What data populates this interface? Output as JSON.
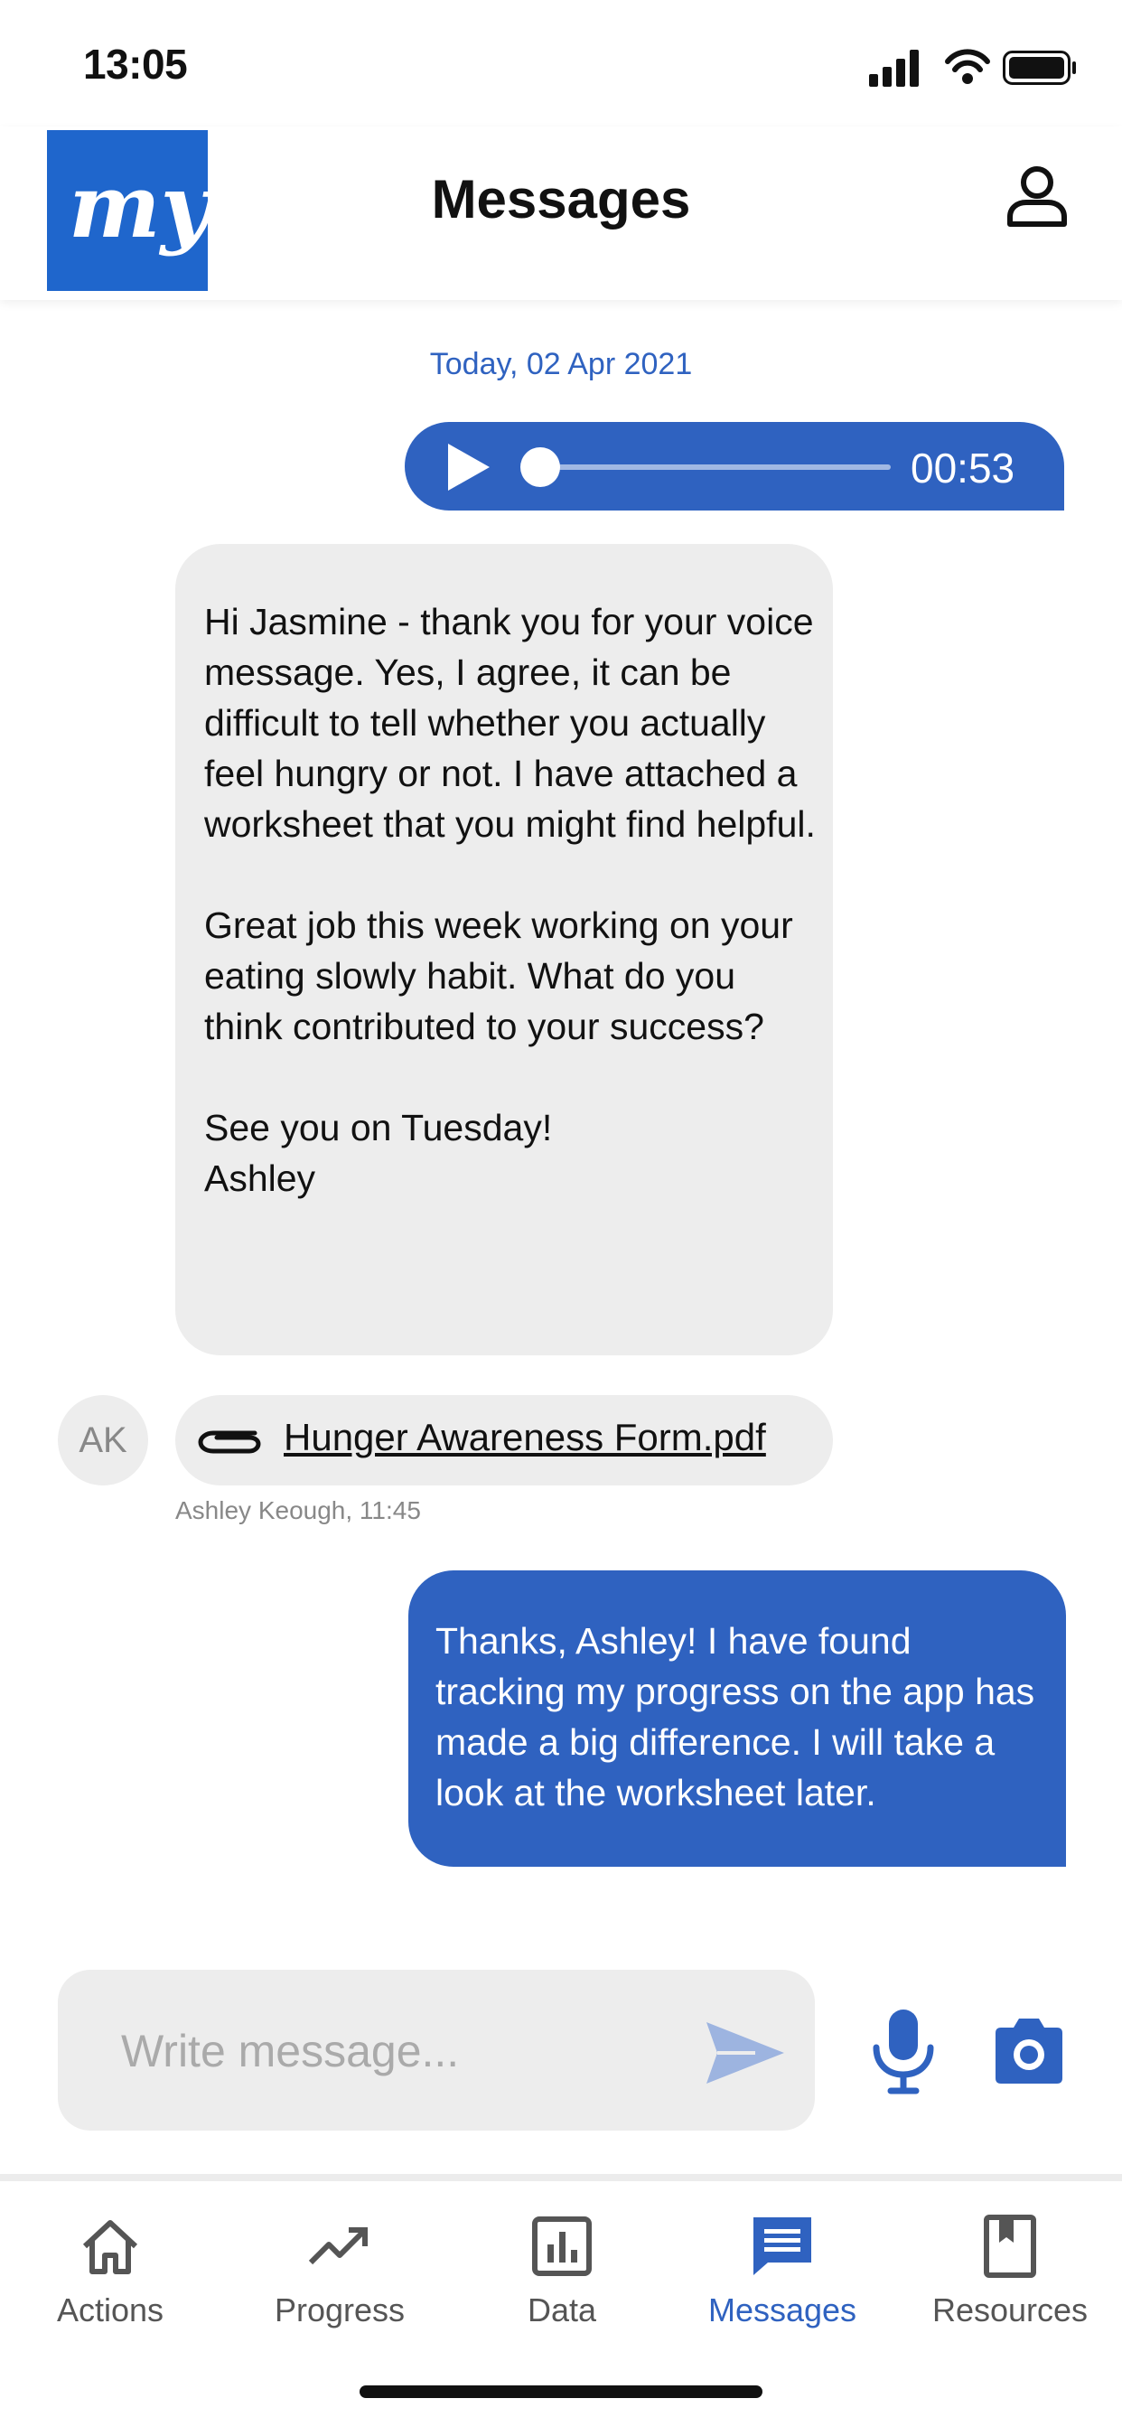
{
  "status_bar": {
    "time": "13:05"
  },
  "header": {
    "logo_text": "my",
    "title": "Messages"
  },
  "conversation": {
    "date_label": "Today, 02 Apr 2021",
    "voice_message": {
      "duration": "00:53",
      "progress": 0
    },
    "incoming_message": {
      "text": "Hi Jasmine - thank you for your voice message. Yes, I agree, it can be difficult to tell whether you actually feel hungry or not. I have attached a worksheet that you might find helpful.\n\nGreat job this week working on your eating slowly habit. What do you think contributed to your success?\n\nSee you on Tuesday!\nAshley"
    },
    "attachment": {
      "avatar_initials": "AK",
      "file_name": "Hunger Awareness Form.pdf",
      "sender_meta": "Ashley Keough, 11:45"
    },
    "outgoing_message": {
      "text": "Thanks, Ashley! I have found tracking my progress on the app has made a big difference. I will take a look at the worksheet later."
    }
  },
  "composer": {
    "placeholder": "Write message...",
    "value": ""
  },
  "tabs": [
    {
      "label": "Actions",
      "icon": "home-icon",
      "active": false
    },
    {
      "label": "Progress",
      "icon": "trend-icon",
      "active": false
    },
    {
      "label": "Data",
      "icon": "chart-icon",
      "active": false
    },
    {
      "label": "Messages",
      "icon": "chat-icon",
      "active": true
    },
    {
      "label": "Resources",
      "icon": "bookmark-icon",
      "active": false
    }
  ],
  "colors": {
    "brand": "#1f66cc",
    "accent": "#2f62c0",
    "bubble_gray": "#ededed",
    "placeholder": "#aaaaaa",
    "meta_text": "#888888"
  }
}
